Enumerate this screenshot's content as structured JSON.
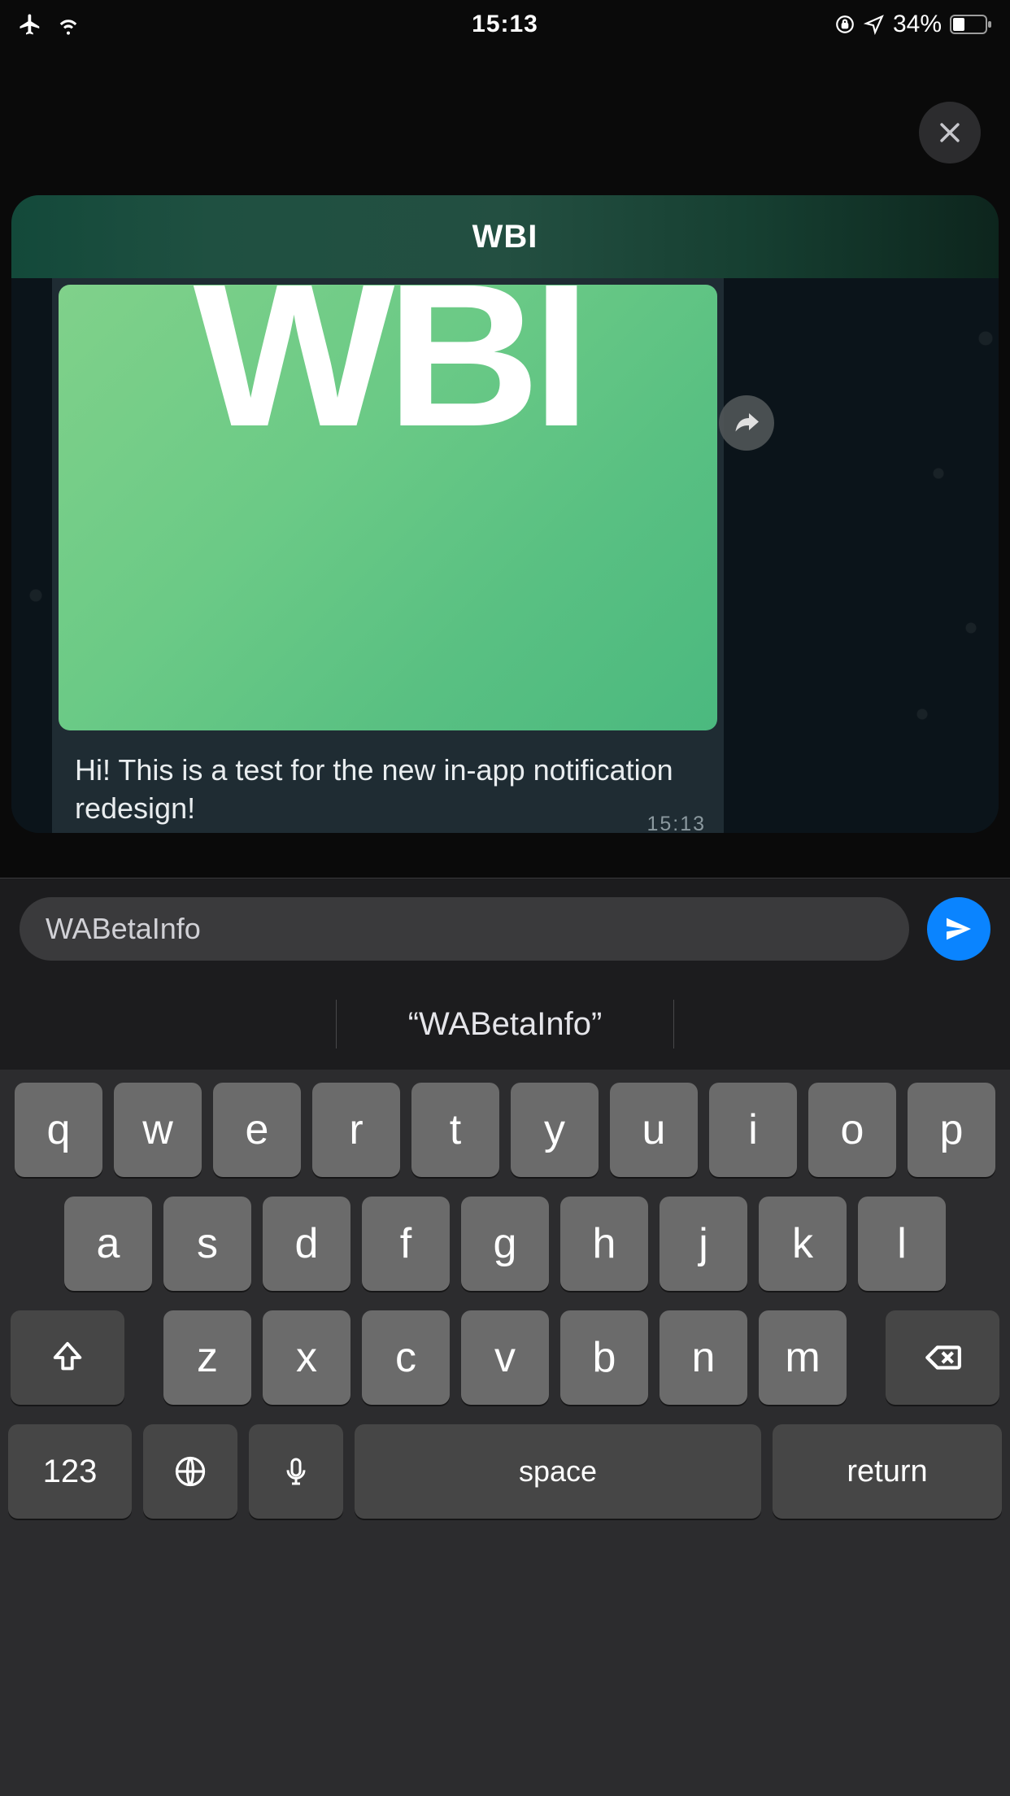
{
  "status": {
    "time": "15:13",
    "battery_pct": "34%"
  },
  "notification": {
    "title": "WBI",
    "image_text": "WBI",
    "message_text": "Hi! This is a test for the new in-app notification redesign!",
    "message_time": "15:13"
  },
  "input": {
    "value": "WABetaInfo"
  },
  "keyboard": {
    "suggestion_left": "",
    "suggestion_center": "“WABetaInfo”",
    "suggestion_right": "",
    "rows": [
      [
        "q",
        "w",
        "e",
        "r",
        "t",
        "y",
        "u",
        "i",
        "o",
        "p"
      ],
      [
        "a",
        "s",
        "d",
        "f",
        "g",
        "h",
        "j",
        "k",
        "l"
      ],
      [
        "z",
        "x",
        "c",
        "v",
        "b",
        "n",
        "m"
      ]
    ],
    "num_label": "123",
    "space_label": "space",
    "return_label": "return"
  }
}
